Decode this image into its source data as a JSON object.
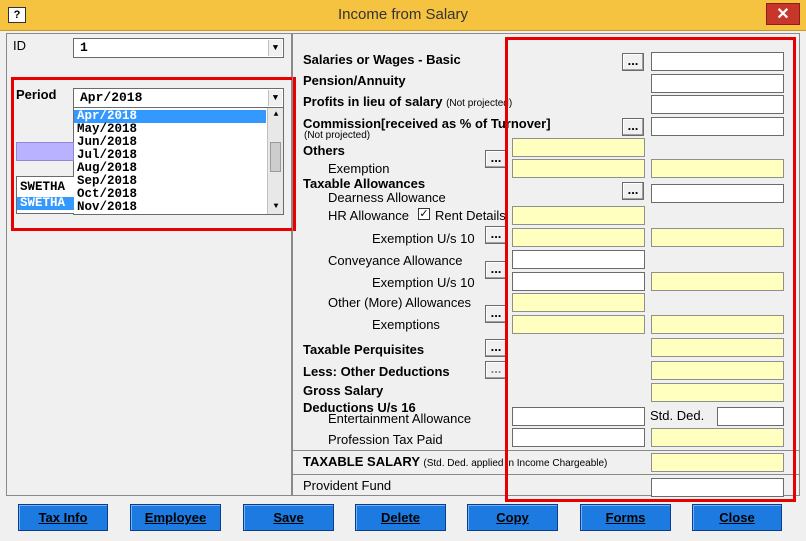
{
  "window": {
    "title": "Income from Salary",
    "close": "✕",
    "icon": "?"
  },
  "left": {
    "id_label": "ID",
    "id_value": "1",
    "period_label": "Period",
    "period_value": "Apr/2018",
    "period_options": [
      "Apr/2018",
      "May/2018",
      "Jun/2018",
      "Jul/2018",
      "Aug/2018",
      "Sep/2018",
      "Oct/2018",
      "Nov/2018"
    ],
    "employee_rows": [
      "SWETHA",
      "SWETHA"
    ]
  },
  "form": {
    "salaries": "Salaries or Wages - Basic",
    "pension": "Pension/Annuity",
    "profits": "Profits in lieu of salary",
    "profits_note": "(Not projected)",
    "commission": "Commission[received as % of Turnover]",
    "commission_note": "(Not projected)",
    "others": "Others",
    "exemption": "Exemption",
    "taxable_allowances": "Taxable Allowances",
    "dearness": "Dearness Allowance",
    "hra": "HR Allowance",
    "rent_details": "Rent Details",
    "exemption_us10_a": "Exemption U/s 10",
    "conveyance": "Conveyance Allowance",
    "exemption_us10_b": "Exemption U/s 10",
    "other_allowances": "Other (More) Allowances",
    "exemptions": "Exemptions",
    "perquisites": "Taxable Perquisites",
    "other_deductions": "Less: Other Deductions",
    "gross_salary": "Gross Salary",
    "deductions_16": "Deductions U/s 16",
    "entertainment": "Entertainment Allowance",
    "std_ded": "Std. Ded.",
    "professional_tax": "Profession Tax Paid",
    "taxable_salary": "TAXABLE SALARY",
    "taxable_note": "(Std. Ded. applied in Income Chargeable)",
    "provident_fund": "Provident Fund",
    "dots": "..."
  },
  "buttons": {
    "tax_info": "Tax Info",
    "employee": "Employee",
    "save": "Save",
    "delete": "Delete",
    "copy": "Copy",
    "forms": "Forms",
    "close": "Close"
  },
  "colors": {
    "title_bar": "#f6c340",
    "highlight_box": "#e80000",
    "yellow_field": "#ffffc0",
    "button": "#1c7ae0"
  }
}
